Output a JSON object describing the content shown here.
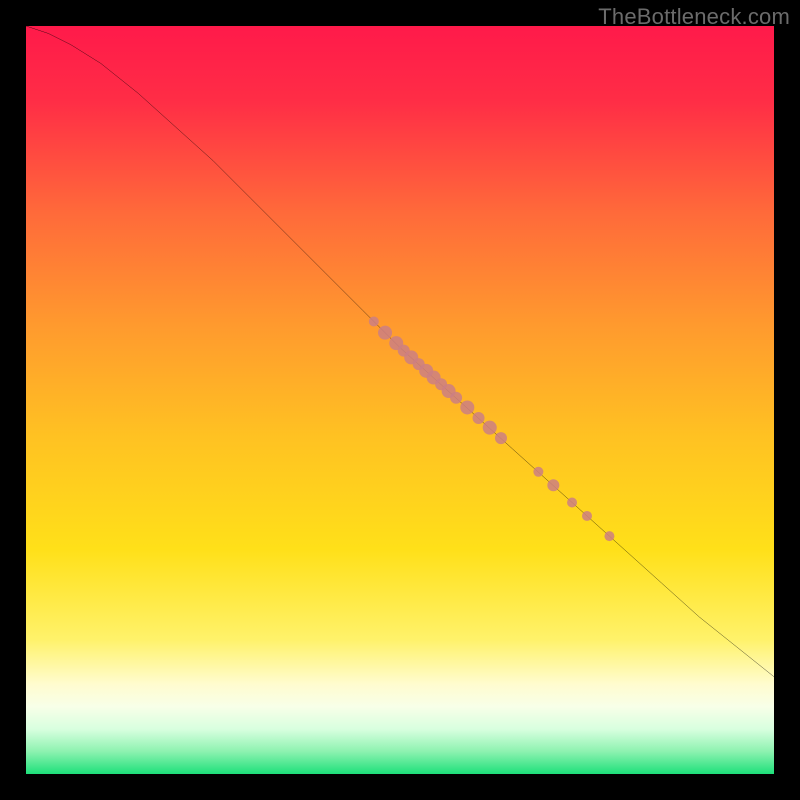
{
  "watermark": "TheBottleneck.com",
  "chart_data": {
    "type": "line",
    "title": "",
    "xlabel": "",
    "ylabel": "",
    "xlim": [
      0,
      100
    ],
    "ylim": [
      0,
      100
    ],
    "grid": false,
    "legend": false,
    "background_gradient": {
      "stops": [
        {
          "pos": 0.0,
          "color": "#ff1a4a"
        },
        {
          "pos": 0.1,
          "color": "#ff2d46"
        },
        {
          "pos": 0.25,
          "color": "#ff6a3a"
        },
        {
          "pos": 0.4,
          "color": "#ff9a2e"
        },
        {
          "pos": 0.55,
          "color": "#ffc222"
        },
        {
          "pos": 0.7,
          "color": "#ffe019"
        },
        {
          "pos": 0.82,
          "color": "#fff26a"
        },
        {
          "pos": 0.88,
          "color": "#fffccf"
        },
        {
          "pos": 0.91,
          "color": "#f8ffe8"
        },
        {
          "pos": 0.94,
          "color": "#d8ffdf"
        },
        {
          "pos": 0.97,
          "color": "#8df2b0"
        },
        {
          "pos": 1.0,
          "color": "#1ee07a"
        }
      ]
    },
    "series": [
      {
        "name": "bottleneck-curve",
        "color": "#000000",
        "x": [
          0,
          3,
          6,
          10,
          15,
          20,
          25,
          30,
          35,
          40,
          45,
          50,
          55,
          60,
          65,
          70,
          75,
          80,
          85,
          90,
          95,
          100
        ],
        "y": [
          100,
          99,
          97.5,
          95,
          91,
          86.5,
          82,
          77,
          72,
          67,
          62,
          57,
          52.5,
          48,
          43.5,
          39,
          34.5,
          30,
          25.5,
          21,
          17,
          13
        ]
      }
    ],
    "scatter": {
      "name": "highlighted-points",
      "color": "#cc7f83",
      "points": [
        {
          "x": 46.5,
          "y": 60.5,
          "r": 5
        },
        {
          "x": 48.0,
          "y": 59.0,
          "r": 7
        },
        {
          "x": 49.5,
          "y": 57.6,
          "r": 7
        },
        {
          "x": 50.5,
          "y": 56.6,
          "r": 6
        },
        {
          "x": 51.5,
          "y": 55.7,
          "r": 7
        },
        {
          "x": 52.5,
          "y": 54.8,
          "r": 6
        },
        {
          "x": 53.5,
          "y": 53.9,
          "r": 7
        },
        {
          "x": 54.5,
          "y": 53.0,
          "r": 7
        },
        {
          "x": 55.5,
          "y": 52.1,
          "r": 6
        },
        {
          "x": 56.5,
          "y": 51.2,
          "r": 7
        },
        {
          "x": 57.5,
          "y": 50.3,
          "r": 6
        },
        {
          "x": 59.0,
          "y": 49.0,
          "r": 7
        },
        {
          "x": 60.5,
          "y": 47.6,
          "r": 6
        },
        {
          "x": 62.0,
          "y": 46.3,
          "r": 7
        },
        {
          "x": 63.5,
          "y": 44.9,
          "r": 6
        },
        {
          "x": 68.5,
          "y": 40.4,
          "r": 5
        },
        {
          "x": 70.5,
          "y": 38.6,
          "r": 6
        },
        {
          "x": 73.0,
          "y": 36.3,
          "r": 5
        },
        {
          "x": 75.0,
          "y": 34.5,
          "r": 5
        },
        {
          "x": 78.0,
          "y": 31.8,
          "r": 5
        }
      ]
    }
  }
}
